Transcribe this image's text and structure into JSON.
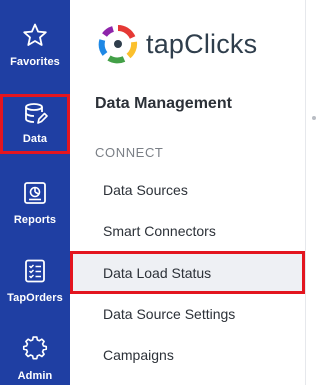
{
  "rail": {
    "items": [
      {
        "label": "Favorites",
        "icon": "star-icon",
        "active": false
      },
      {
        "label": "Data",
        "icon": "database-icon",
        "active": true
      },
      {
        "label": "Reports",
        "icon": "report-icon",
        "active": false
      },
      {
        "label": "TapOrders",
        "icon": "checklist-icon",
        "active": false
      },
      {
        "label": "Admin",
        "icon": "gear-icon",
        "active": false
      }
    ],
    "background": "#1f3fa3",
    "highlight": "#e3151f"
  },
  "menu": {
    "logo_text": "tapClicks",
    "section_title": "Data Management",
    "group_label": "CONNECT",
    "items": [
      {
        "label": "Data Sources",
        "selected": false
      },
      {
        "label": "Smart Connectors",
        "selected": false
      },
      {
        "label": "Data Load Status",
        "selected": true
      },
      {
        "label": "Data Source Settings",
        "selected": false
      },
      {
        "label": "Campaigns",
        "selected": false
      }
    ]
  }
}
